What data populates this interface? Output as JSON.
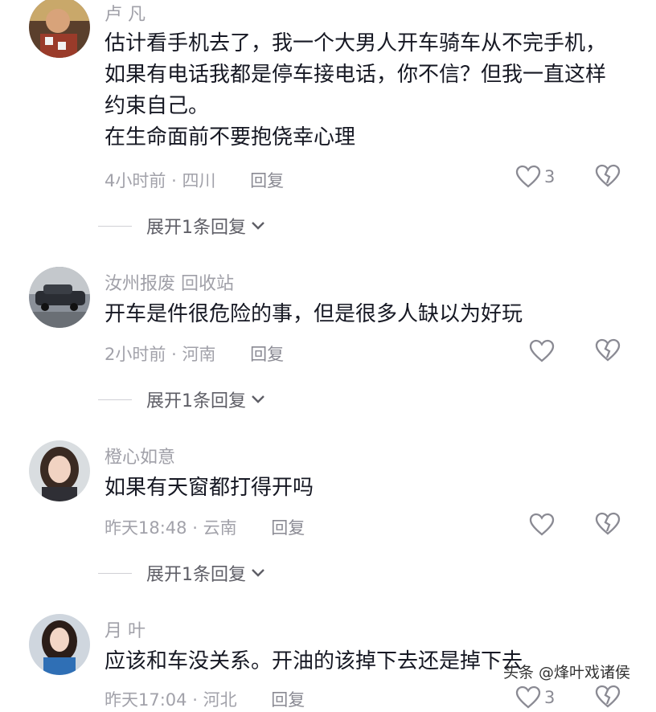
{
  "comments": [
    {
      "username": "卢 凡",
      "text_lines": [
        "估计看手机去了，我一个大男人开车骑车从不完手机，",
        "如果有电话我都是停车接电话，你不信？但我一直这样",
        "约束自己。",
        "在生命面前不要抱侥幸心理"
      ],
      "time": "4小时前",
      "location": "四川",
      "reply": "回复",
      "likes": "3",
      "expand": "展开1条回复"
    },
    {
      "username": "汝州报废   回收站",
      "text_lines": [
        "开车是件很危险的事，但是很多人缺以为好玩"
      ],
      "time": "2小时前",
      "location": "河南",
      "reply": "回复",
      "likes": "",
      "expand": "展开1条回复"
    },
    {
      "username": "橙心如意",
      "text_lines": [
        "如果有天窗都打得开吗"
      ],
      "time": "昨天18:48",
      "location": "云南",
      "reply": "回复",
      "likes": "",
      "expand": "展开1条回复"
    },
    {
      "username": "月   叶",
      "text_lines": [
        "应该和车没关系。开油的该掉下去还是掉下去"
      ],
      "time": "昨天17:04",
      "location": "河北",
      "reply": "回复",
      "likes": "3",
      "expand": ""
    }
  ],
  "separator": "·",
  "watermark": "头条 @烽叶戏诸侯",
  "colors": {
    "text": "#161823",
    "meta": "#a2a2aa",
    "accent": "#8a8a93"
  },
  "icons": [
    "heart-icon",
    "broken-heart-icon",
    "chevron-down-icon"
  ]
}
